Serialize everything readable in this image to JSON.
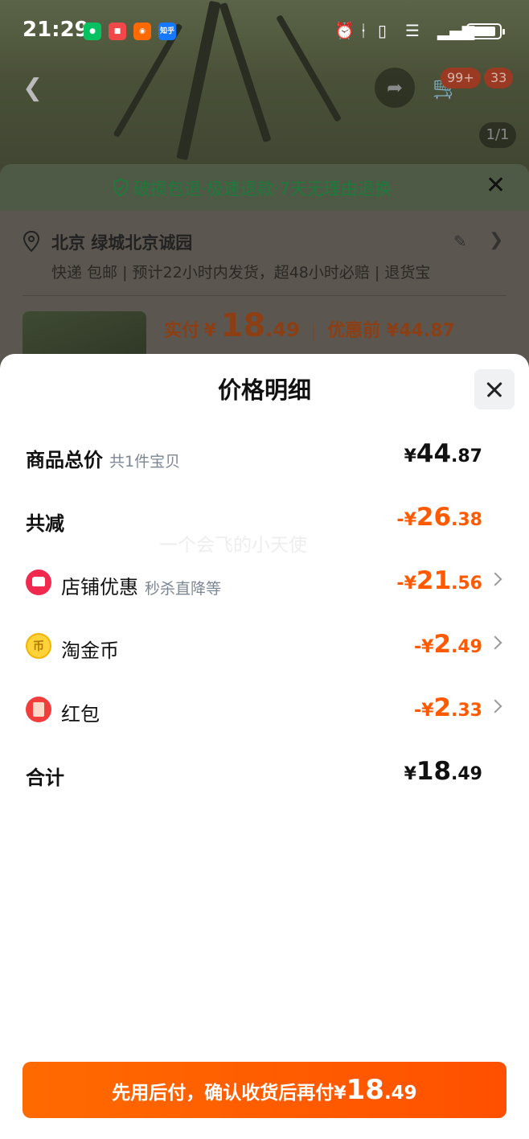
{
  "status_bar": {
    "time": "21:29",
    "apps": [
      {
        "name": "wechat-icon",
        "color": "#07c160",
        "label": ""
      },
      {
        "name": "notes-icon",
        "color": "#f04848",
        "label": ""
      },
      {
        "name": "taobao-app-icon",
        "color": "#ff6a00",
        "label": ""
      },
      {
        "name": "zhihu-icon",
        "color": "#1677ff",
        "label": "知乎"
      }
    ],
    "battery_level": 0.9
  },
  "product_page": {
    "cart_badge": "99+",
    "message_badge": "33",
    "image_counter": "1/1",
    "guarantee": "破损包退·极速退款·7天无理由退换",
    "address": "北京 绿城北京诚园",
    "shipping": "快递 包邮 | 预计22小时内发货，超48小时必赔 | 退货宝",
    "paid_label": "实付",
    "paid_currency": "¥",
    "paid_int": "18",
    "paid_dec": ".49",
    "before_label": "优惠前 ¥44.87"
  },
  "price_detail": {
    "title": "价格明细",
    "watermark": "一个会飞的小天使",
    "rows": [
      {
        "name": "商品总价",
        "sub": "共1件宝贝",
        "sign": "",
        "currency": "¥",
        "int": "44",
        "dec": ".87",
        "color": "#111111"
      },
      {
        "name": "共减",
        "sub": "",
        "sign": "-",
        "currency": "¥",
        "int": "26",
        "dec": ".38",
        "color": "#ff5a00"
      },
      {
        "name": "店铺优惠",
        "sub": "秒杀直降等",
        "sign": "-",
        "currency": "¥",
        "int": "21",
        "dec": ".56",
        "color": "#ff5a00",
        "icon": "shop-discount-icon"
      },
      {
        "name": "淘金币",
        "sub": "",
        "sign": "-",
        "currency": "¥",
        "int": "2",
        "dec": ".49",
        "color": "#ff5a00",
        "icon": "gold-coin-icon"
      },
      {
        "name": "红包",
        "sub": "",
        "sign": "-",
        "currency": "¥",
        "int": "2",
        "dec": ".33",
        "color": "#ff5a00",
        "icon": "red-packet-icon"
      },
      {
        "name": "合计",
        "sub": "",
        "sign": "",
        "currency": "¥",
        "int": "18",
        "dec": ".49",
        "color": "#111111"
      }
    ],
    "pay_button": {
      "text": "先用后付，确认收货后再付",
      "currency": "¥",
      "int": "18",
      "dec": ".49",
      "color": "#ff5a00"
    }
  }
}
